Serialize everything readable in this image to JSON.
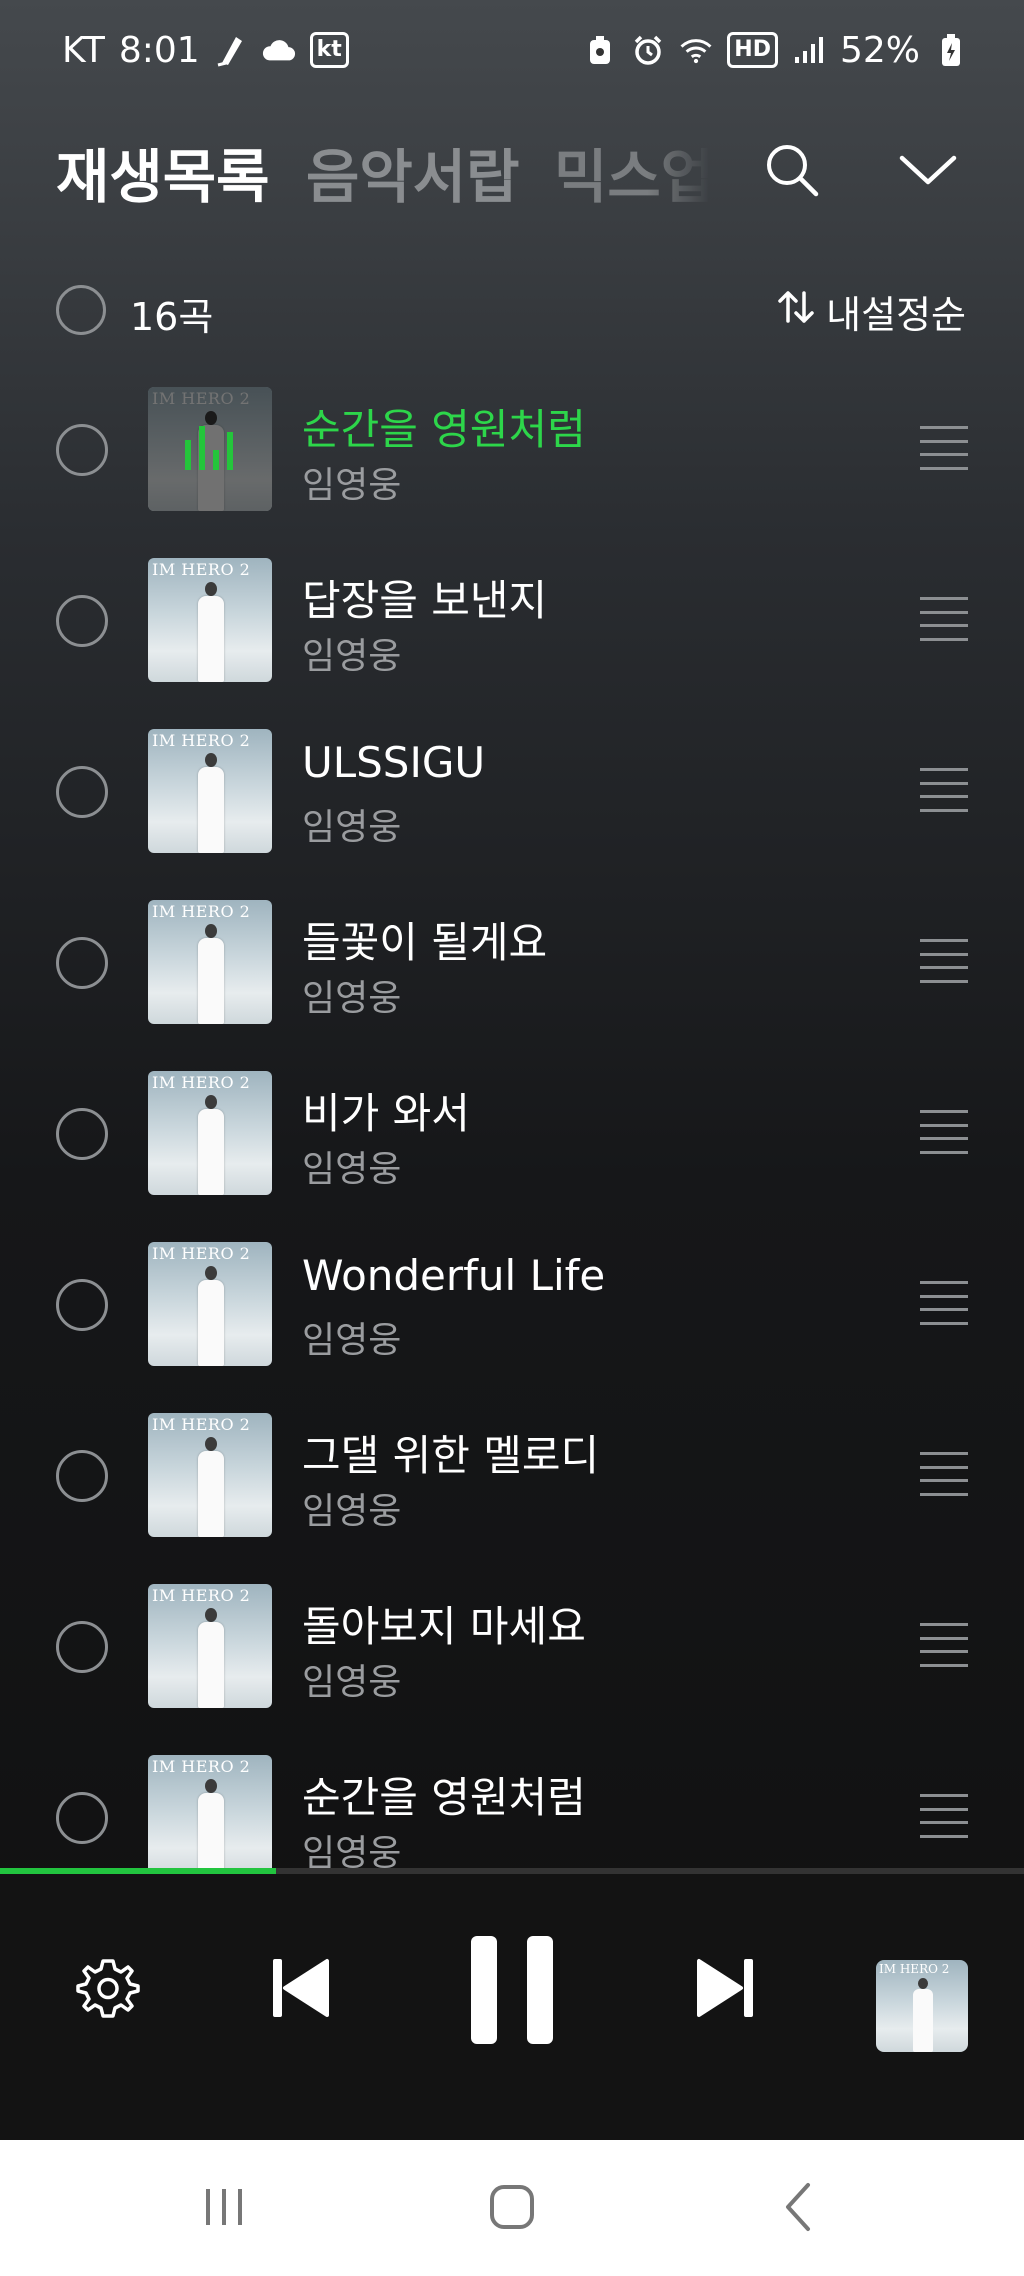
{
  "status_bar": {
    "carrier": "KT",
    "time": "8:01",
    "carrier_badge": "kt",
    "hd_label": "HD",
    "battery": "52%"
  },
  "header": {
    "tabs": [
      {
        "label": "재생목록",
        "active": true
      },
      {
        "label": "음악서랍",
        "active": false
      },
      {
        "label": "믹스업",
        "active": false
      }
    ]
  },
  "toolbar": {
    "count_label": "16곡",
    "sort_label": "내설정순"
  },
  "tracks": [
    {
      "title": "순간을 영원처럼",
      "artist": "임영웅",
      "playing": true
    },
    {
      "title": "답장을 보낸지",
      "artist": "임영웅",
      "playing": false
    },
    {
      "title": "ULSSIGU",
      "artist": "임영웅",
      "playing": false
    },
    {
      "title": "들꽃이 될게요",
      "artist": "임영웅",
      "playing": false
    },
    {
      "title": "비가 와서",
      "artist": "임영웅",
      "playing": false
    },
    {
      "title": "Wonderful Life",
      "artist": "임영웅",
      "playing": false
    },
    {
      "title": "그댈 위한 멜로디",
      "artist": "임영웅",
      "playing": false
    },
    {
      "title": "돌아보지 마세요",
      "artist": "임영웅",
      "playing": false
    },
    {
      "title": "순간을 영원처럼",
      "artist": "임영웅",
      "playing": false
    }
  ],
  "album_art_text": "IM HERO 2",
  "player": {
    "progress": 0.27,
    "state": "playing"
  },
  "colors": {
    "accent": "#2dd64a",
    "background_top": "#45494d",
    "background_bottom": "#101010",
    "player_bg": "#131313",
    "nav_bg": "#ffffff"
  },
  "icons": [
    "gear-icon",
    "skip-previous-icon",
    "pause-icon",
    "skip-next-icon",
    "search-icon",
    "chevron-down-icon",
    "sort-icon",
    "drag-handle-icon",
    "recent-apps-icon",
    "home-icon",
    "back-icon"
  ]
}
